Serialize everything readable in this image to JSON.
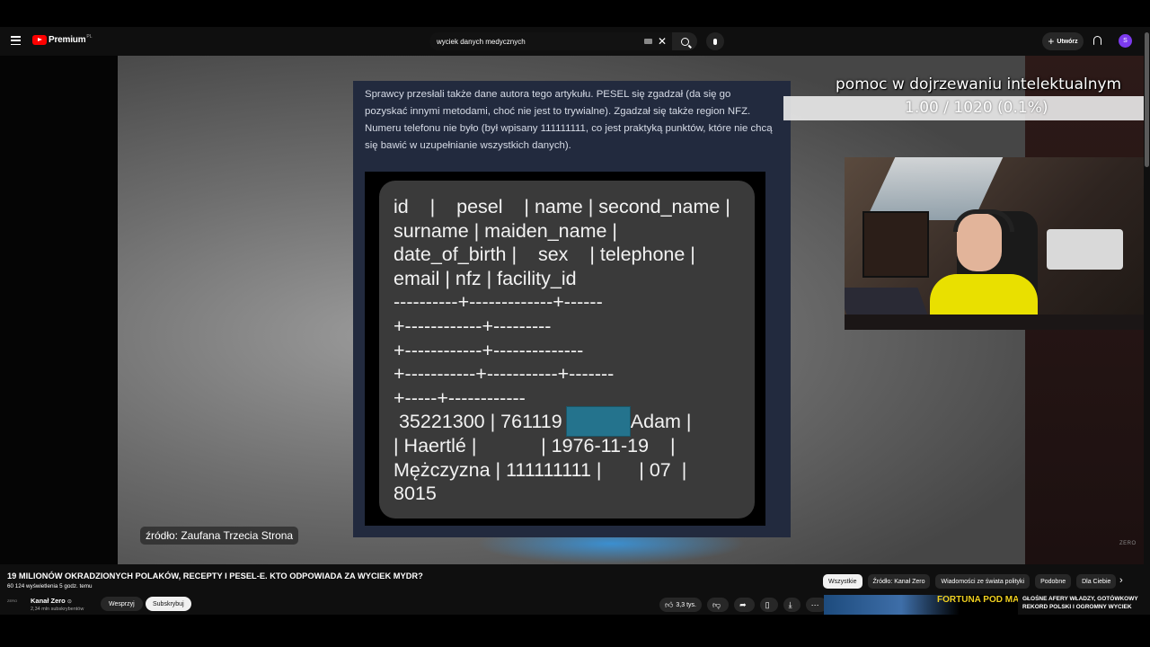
{
  "header": {
    "brand": "Premium",
    "brand_region": "PL",
    "search_value": "wyciek danych medycznych",
    "create_label": "Utwórz",
    "avatar_letter": "S"
  },
  "video": {
    "article_text": "Sprawcy przesłali także dane autora tego artykułu. PESEL się zgadzał (da się go pozyskać innymi metodami, choć nie jest to trywialne). Zgadzał się także region NFZ. Numeru telefonu nie było (był wpisany 111111111, co jest praktyką punktów, które nie chcą się bawić w uzupełnianie wszystkich danych).",
    "db_lines": [
      "id    |    pesel    | name | second_name |",
      "surname | maiden_name |",
      "date_of_birth |    sex    | telephone |",
      "email | nfz | facility_id",
      "----------+-------------+------",
      "+------------+---------",
      "+------------+--------------",
      "+-----------+-----------+-------",
      "+-----+------------",
      " 35221300 | 761119           | Adam |",
      "| Haertlé |            | 1976-11-19    |",
      "Mężczyzna | 111111111 |       | 07  |",
      "8015"
    ],
    "source_label": "źródło: Zaufana Trzecia Strona",
    "watermark": "ZERO",
    "overlay_title": "pomoc w dojrzewaniu intelektualnym",
    "overlay_count": "1.00 / 1020 (0.1%)"
  },
  "info": {
    "title": "19 MILIONÓW OKRADZIONYCH POLAKÓW, RECEPTY I PESEL-E. KTO ODPOWIADA ZA WYCIEK MYDR?",
    "meta": "60 124 wyświetlenia  5 godz. temu",
    "channel_logo": "ZERO",
    "channel_name": "Kanał Zero",
    "verified": "⊙",
    "subscribers": "2,34 mln subskrybentów",
    "support_label": "Wesprzyj",
    "subscribe_label": "Subskrybuj",
    "likes": "3,3 tys."
  },
  "chips": [
    "Wszystkie",
    "Źródło: Kanał Zero",
    "Wiadomości ze świata polityki",
    "Podobne",
    "Dla Ciebie"
  ],
  "recommendation": {
    "thumb_text": "FORTUNA POD MATERACEM?!",
    "title": "GŁOŚNE AFERY WŁADZY, GOTÓWKOWY REKORD POLSKI I OGROMNY WYCIEK"
  }
}
